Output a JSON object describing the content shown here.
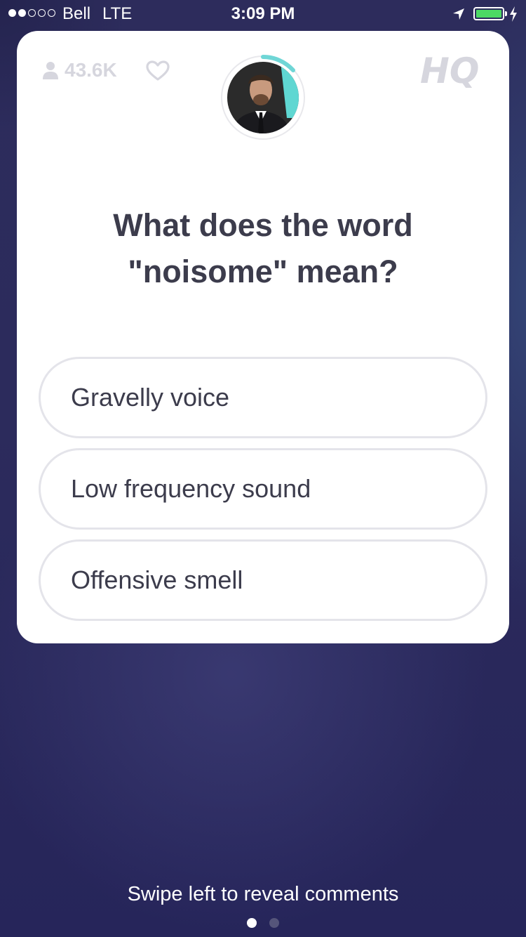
{
  "status_bar": {
    "carrier": "Bell",
    "network": "LTE",
    "time": "3:09 PM",
    "signal_strength": 2,
    "signal_max": 5,
    "battery_level": 1.0,
    "battery_color": "#4cd964",
    "icons": [
      "location-arrow-icon",
      "battery-icon",
      "charging-bolt-icon"
    ]
  },
  "game": {
    "viewer_count": "43.6K",
    "logo": "HQ",
    "timer_color": "#6fd6d6",
    "question": "What does the word \"noisome\" mean?",
    "answers": [
      {
        "label": "Gravelly voice"
      },
      {
        "label": "Low frequency sound"
      },
      {
        "label": "Offensive smell"
      }
    ]
  },
  "footer": {
    "hint": "Swipe left to reveal comments",
    "pages": 2,
    "active_page": 1
  }
}
